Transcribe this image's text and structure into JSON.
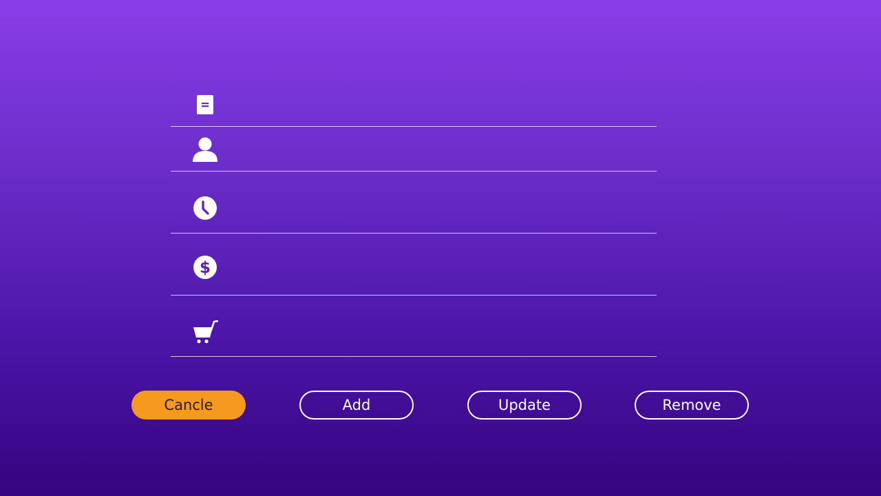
{
  "form": {
    "fields": [
      {
        "icon": "document-icon",
        "value": "",
        "placeholder": ""
      },
      {
        "icon": "person-icon",
        "value": "",
        "placeholder": ""
      },
      {
        "icon": "clock-icon",
        "value": "",
        "placeholder": ""
      },
      {
        "icon": "dollar-icon",
        "value": "",
        "placeholder": ""
      },
      {
        "icon": "cart-icon",
        "value": "",
        "placeholder": ""
      }
    ]
  },
  "actions": {
    "cancel_label": "Cancle",
    "add_label": "Add",
    "update_label": "Update",
    "remove_label": "Remove"
  },
  "colors": {
    "background_top": "#8a3ee8",
    "background_bottom": "#35047e",
    "accent": "#f5991f",
    "foreground": "#ffffff"
  }
}
